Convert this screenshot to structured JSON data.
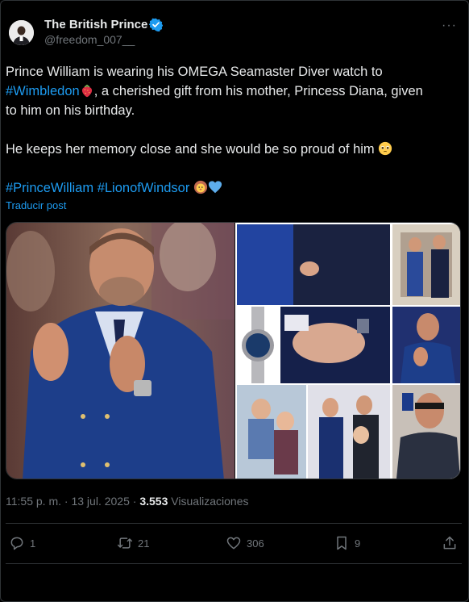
{
  "author": {
    "name": "The British Prince",
    "handle": "@freedom_007__"
  },
  "menu": {
    "more_label": "···"
  },
  "post": {
    "line1_pre": "Prince William is wearing his OMEGA Seamaster Diver watch to",
    "hashtag1": "#Wimbledon",
    "emoji_strawberry": "strawberry-emoji",
    "line2_post": ", a cherished gift from his mother, Princess Diana, given",
    "line3": "to him on his birthday.",
    "line4": "He keeps her memory close and she would be so proud of him",
    "emoji_pleading": "pleading-face-emoji",
    "hashtag2": "#PrinceWilliam",
    "hashtag3": "#LionofWindsor",
    "emoji_lion": "lion-emoji",
    "emoji_heart": "blue-heart-emoji",
    "translate_label": "Traducir post"
  },
  "meta": {
    "time": "11:55 p. m.",
    "separator": " · ",
    "date": "13 jul. 2025",
    "views_count": "3.553",
    "views_label": "Visualizaciones"
  },
  "actions": {
    "replies": "1",
    "reposts": "21",
    "likes": "306",
    "bookmarks": "9"
  },
  "colors": {
    "accent": "#1d9bf0",
    "muted": "#71767b",
    "text": "#e7e9ea",
    "background": "#000000",
    "border": "#2f3336"
  }
}
